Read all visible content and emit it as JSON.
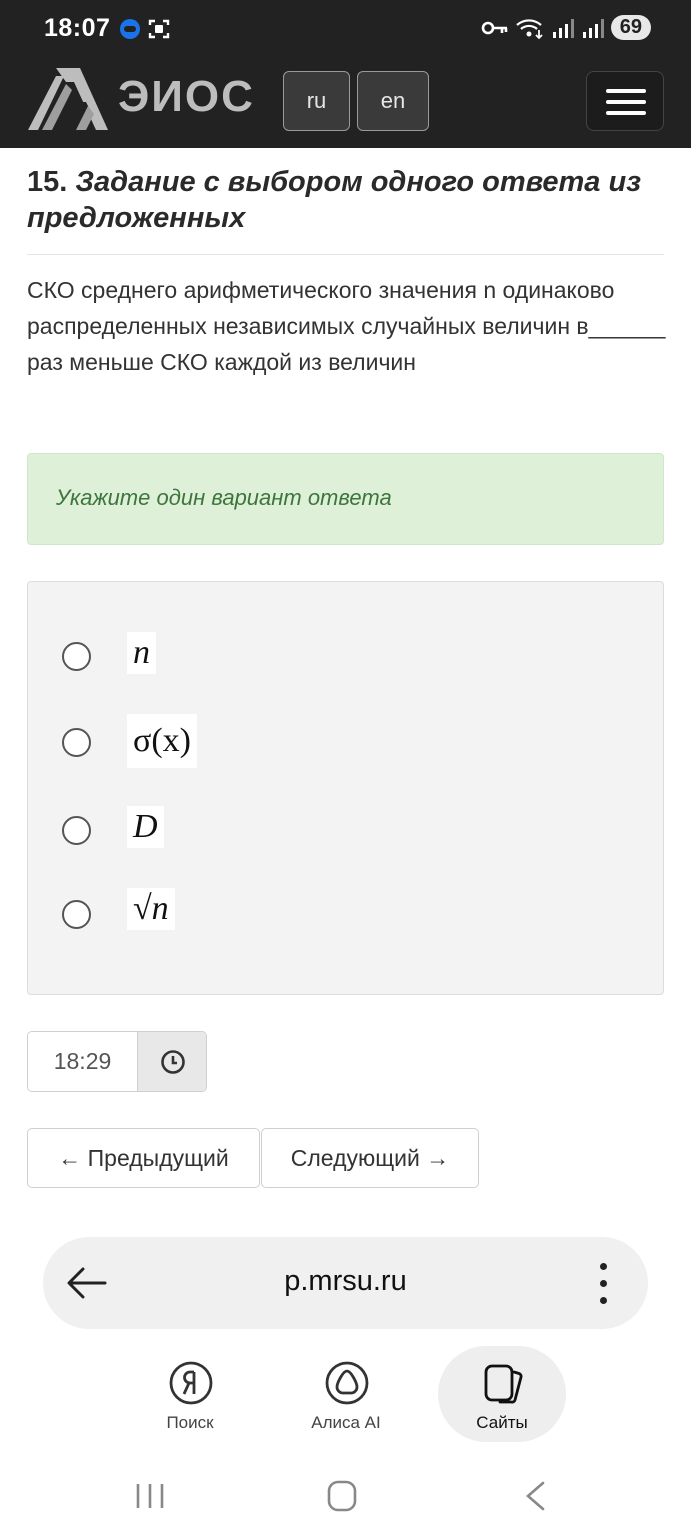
{
  "status_bar": {
    "time": "18:07",
    "battery": "69"
  },
  "header": {
    "logo_text": "ЭИОС",
    "lang_ru": "ru",
    "lang_en": "en"
  },
  "question": {
    "number": "15.",
    "title": "Задание с выбором одного ответа из предложенных",
    "text": "СКО среднего арифметического значения n одинаково распределенных независимых случайных величин в______  раз меньше СКО каждой из величин",
    "hint": "Укажите один вариант ответа",
    "options": [
      "n",
      "σ(x)",
      "D",
      "√n"
    ]
  },
  "timer": {
    "value": "18:29"
  },
  "navigation": {
    "prev_label": "← Предыдущий",
    "next_label": "Следующий →"
  },
  "browser": {
    "url": "p.mrsu.ru",
    "tabs": {
      "search": "Поиск",
      "alice": "Алиса AI",
      "sites": "Сайты"
    }
  }
}
